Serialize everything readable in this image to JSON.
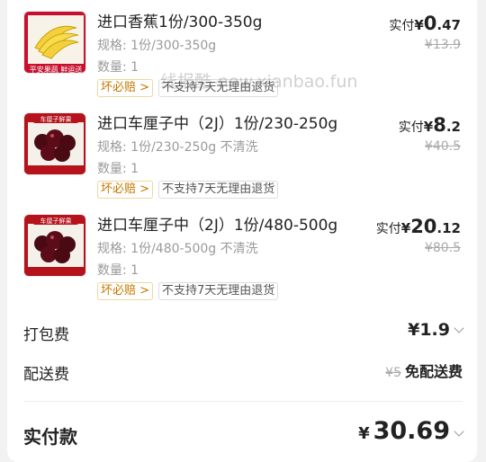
{
  "items": [
    {
      "title": "进口香蕉1份/300-350g",
      "spec": "规格: 1份/300-350g",
      "qty": "数量: 1",
      "tags": [
        "坏必赔 >",
        "不支持7天无理由退货"
      ],
      "pay_label": "实付",
      "yen": "¥",
      "price_int": "0",
      "price_dec": ".47",
      "original": "¥13.9",
      "image_icon": "banana-image",
      "image_banner": "平安果蔬 鲜运送"
    },
    {
      "title": "进口车厘子中（2J）1份/230-250g",
      "spec": "规格: 1份/230-250g 不清洗",
      "qty": "数量: 1",
      "tags": [
        "坏必赔 >",
        "不支持7天无理由退货"
      ],
      "pay_label": "实付",
      "yen": "¥",
      "price_int": "8",
      "price_dec": ".2",
      "original": "¥40.5",
      "image_icon": "cherries-image",
      "image_banner": "车厘子鲜果"
    },
    {
      "title": "进口车厘子中（2J）1份/480-500g",
      "spec": "规格: 1份/480-500g 不清洗",
      "qty": "数量: 1",
      "tags": [
        "坏必赔 >",
        "不支持7天无理由退货"
      ],
      "pay_label": "实付",
      "yen": "¥",
      "price_int": "20",
      "price_dec": ".12",
      "original": "¥80.5",
      "image_icon": "cherries-image",
      "image_banner": "车厘子鲜果"
    }
  ],
  "packing": {
    "label": "打包费",
    "value": "¥1.9"
  },
  "delivery": {
    "label": "配送费",
    "original": "¥5",
    "value": "免配送费"
  },
  "total": {
    "label": "实付款",
    "yen": "¥",
    "value": "30.69"
  },
  "watermark": "线报酷-new.xianbao.fun",
  "colors": {
    "accent": "#c47800",
    "text": "#222222",
    "muted": "#9a9a9a"
  }
}
